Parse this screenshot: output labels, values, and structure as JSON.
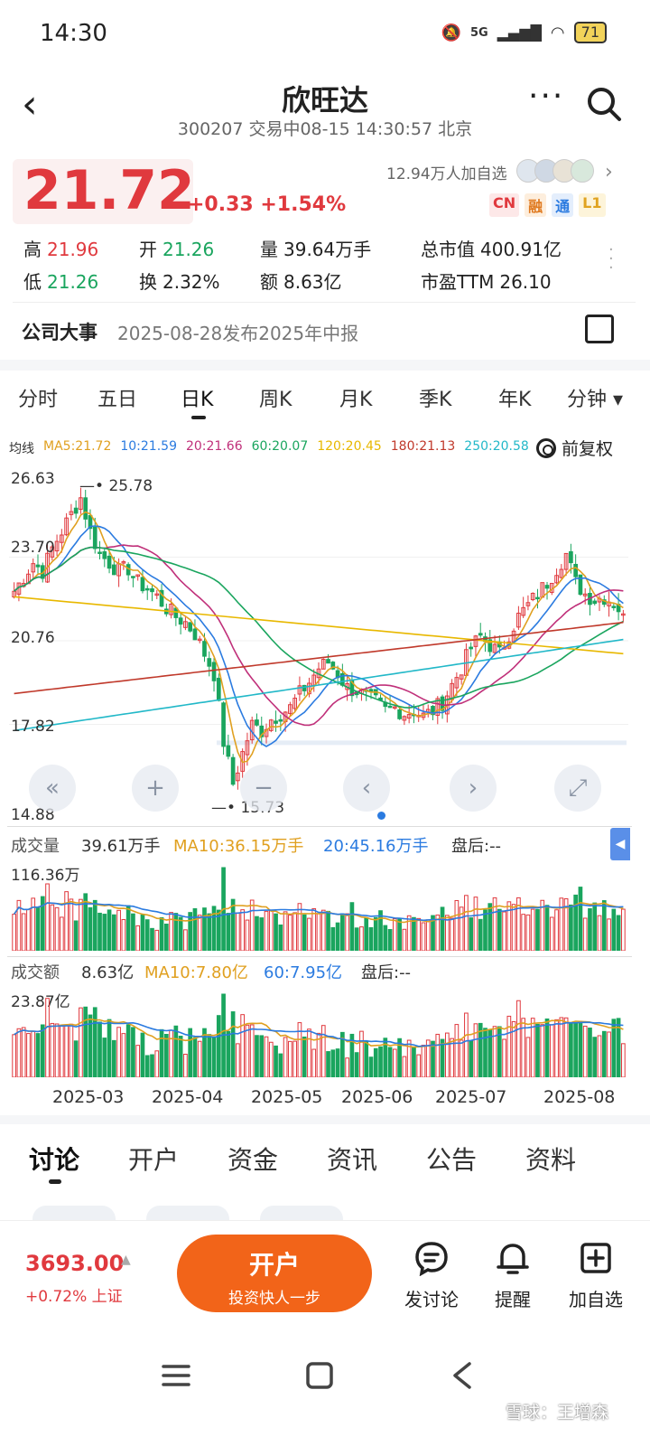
{
  "status_bar": {
    "time": "14:30",
    "network": "5G",
    "battery": "71"
  },
  "header": {
    "title": "欣旺达",
    "subtitle": "300207 交易中08-15 14:30:57 北京"
  },
  "quote": {
    "price": "21.72",
    "change": "+0.33 +1.54%",
    "followers": "12.94万人加自选",
    "badges": [
      "CN",
      "融",
      "通",
      "L1"
    ],
    "stats": [
      {
        "label": "高",
        "value": "21.96",
        "tone": "red"
      },
      {
        "label": "开",
        "value": "21.26",
        "tone": "green"
      },
      {
        "label": "量",
        "value": "39.64万手",
        "tone": "plain"
      },
      {
        "label": "总市值",
        "value": "400.91亿",
        "tone": "plain"
      },
      {
        "label": "低",
        "value": "21.26",
        "tone": "green"
      },
      {
        "label": "换",
        "value": "2.32%",
        "tone": "plain"
      },
      {
        "label": "额",
        "value": "8.63亿",
        "tone": "plain"
      },
      {
        "label": "市盈TTM",
        "value": "26.10",
        "tone": "plain"
      }
    ]
  },
  "event": {
    "title": "公司大事",
    "text": "2025-08-28发布2025年中报"
  },
  "period_tabs": [
    "分时",
    "五日",
    "日K",
    "周K",
    "月K",
    "季K",
    "年K",
    "分钟 ▾"
  ],
  "active_period": "日K",
  "ma_legend": [
    {
      "text": "均线",
      "color": "#333333"
    },
    {
      "text": "MA5:21.72",
      "color": "#e0a020"
    },
    {
      "text": "10:21.59",
      "color": "#2b7be0"
    },
    {
      "text": "20:21.66",
      "color": "#c0307a"
    },
    {
      "text": "60:20.07",
      "color": "#1aa55e"
    },
    {
      "text": "120:20.45",
      "color": "#e8b800"
    },
    {
      "text": "180:21.13",
      "color": "#c0392b"
    },
    {
      "text": "250:20.58",
      "color": "#22b8c8"
    }
  ],
  "fuquan_label": "前复权",
  "chart_data": {
    "type": "candlestick",
    "y_axis_labels": [
      "26.63",
      "23.70",
      "20.76",
      "17.82",
      "14.88"
    ],
    "ylim": [
      14.88,
      26.63
    ],
    "annotations": [
      {
        "label": "25.78",
        "note": "区间最高"
      },
      {
        "label": "15.73",
        "note": "区间最低"
      }
    ],
    "x_labels": [
      "2025-03",
      "2025-04",
      "2025-05",
      "2025-06",
      "2025-07",
      "2025-08"
    ],
    "colors": {
      "up": "#e0393e",
      "down": "#1aa55e"
    },
    "ohlc_path": [
      22.5,
      23.0,
      23.5,
      23.2,
      24.0,
      24.6,
      25.2,
      25.78,
      24.6,
      23.8,
      23.5,
      23.2,
      23.3,
      22.8,
      22.6,
      22.3,
      21.9,
      21.6,
      21.4,
      21.0,
      20.3,
      19.6,
      17.2,
      15.73,
      16.8,
      17.8,
      17.6,
      18.0,
      18.2,
      18.4,
      18.9,
      19.3,
      19.8,
      20.0,
      19.6,
      19.1,
      19.0,
      18.8,
      18.6,
      18.3,
      18.4,
      18.2,
      18.3,
      18.1,
      18.3,
      18.6,
      19.2,
      19.8,
      20.5,
      20.9,
      20.6,
      20.3,
      21.0,
      21.6,
      22.0,
      22.4,
      22.8,
      23.3,
      23.8,
      22.8,
      22.4,
      22.2,
      22.3,
      22.1,
      21.7
    ],
    "volume": {
      "title": "成交量",
      "latest": "39.61万手",
      "ma10": "MA10:36.15万手",
      "ma20": "20:45.16万手",
      "after": "盘后:--",
      "max_label": "116.36万"
    },
    "turnover": {
      "title": "成交额",
      "latest": "8.63亿",
      "ma10": "MA10:7.80亿",
      "ma60": "60:7.95亿",
      "after": "盘后:--",
      "max_label": "23.87亿"
    }
  },
  "chart_controls": [
    "«",
    "+",
    "−",
    "‹",
    "›",
    "⤢"
  ],
  "bottom_tabs": [
    "讨论",
    "开户",
    "资金",
    "资讯",
    "公告",
    "资料"
  ],
  "active_bottom_tab": "讨论",
  "index": {
    "value": "3693.00",
    "change": "+0.72% 上证"
  },
  "open_account": {
    "title": "开户",
    "subtitle": "投资快人一步"
  },
  "actions": [
    {
      "label": "发讨论",
      "icon": "comment-icon"
    },
    {
      "label": "提醒",
      "icon": "bell-icon"
    },
    {
      "label": "加自选",
      "icon": "add-watchlist-icon"
    }
  ],
  "watermark": "雪球：王增森"
}
